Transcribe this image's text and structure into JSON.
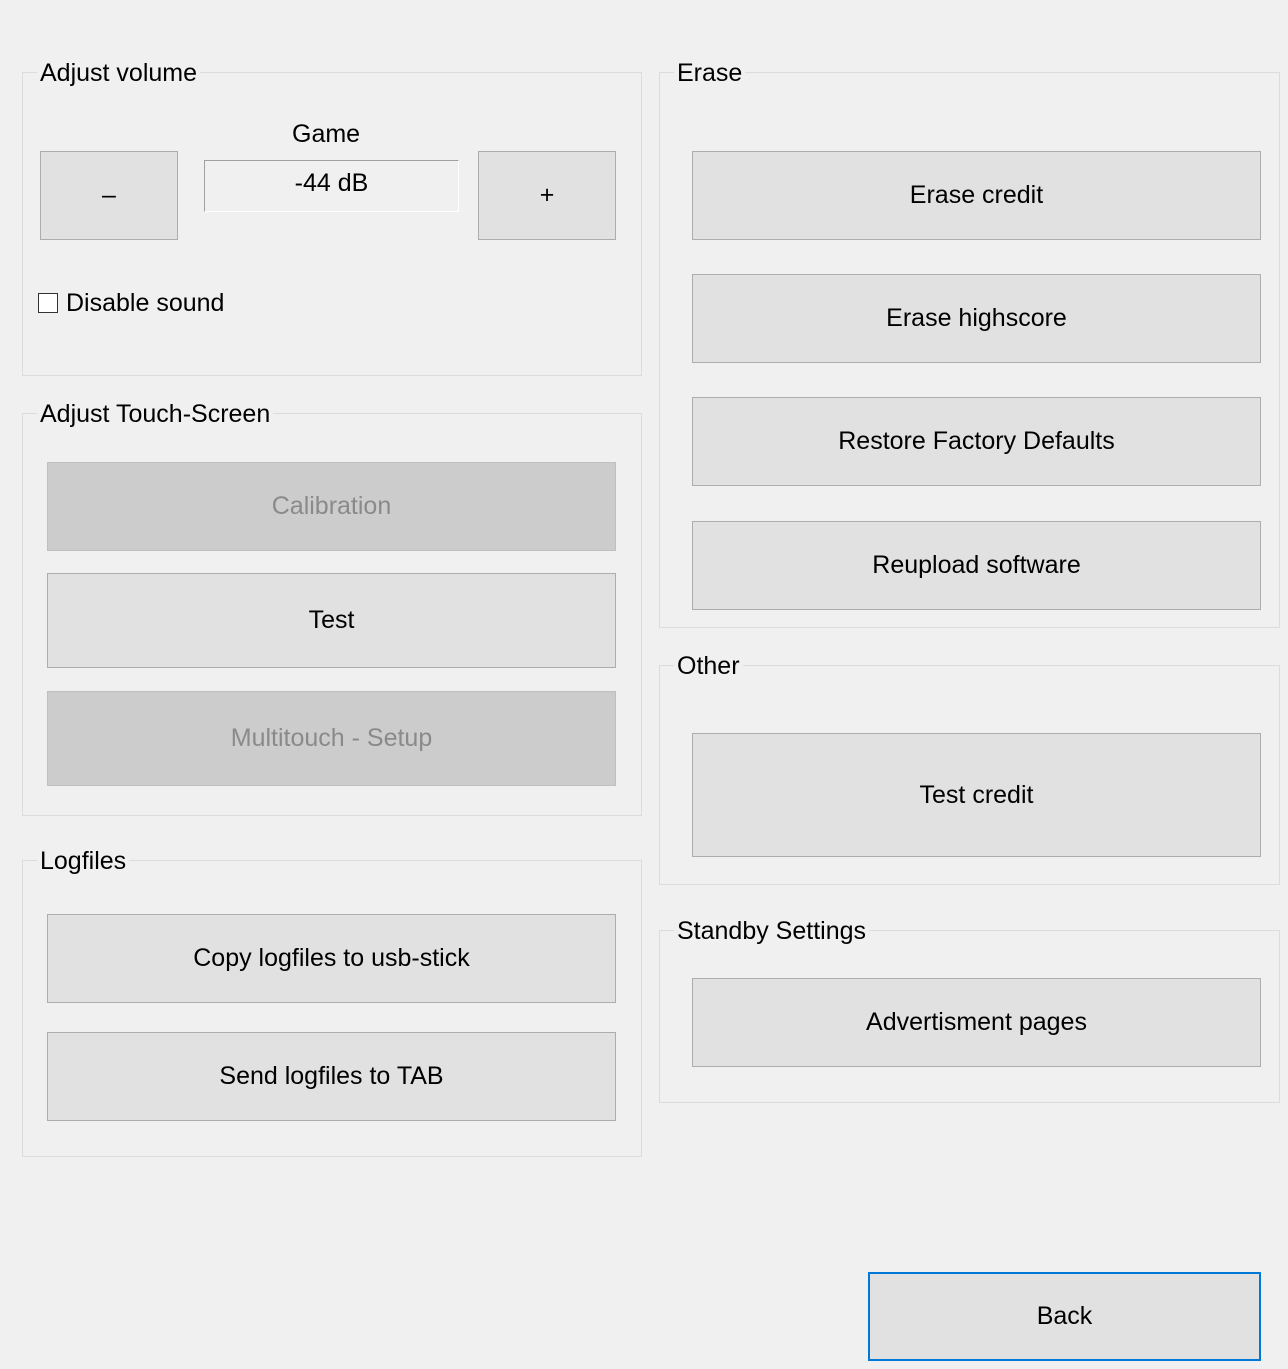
{
  "volume": {
    "title": "Adjust volume",
    "channel_label": "Game",
    "level": "-44 dB",
    "decrease_label": "–",
    "increase_label": "+",
    "disable_sound_label": "Disable sound",
    "disable_sound_checked": false
  },
  "touch": {
    "title": "Adjust Touch-Screen",
    "calibration_label": "Calibration",
    "test_label": "Test",
    "multitouch_label": "Multitouch - Setup"
  },
  "logfiles": {
    "title": "Logfiles",
    "copy_label": "Copy logfiles to usb-stick",
    "send_label": "Send logfiles to TAB"
  },
  "erase": {
    "title": "Erase",
    "erase_credit_label": "Erase credit",
    "erase_highscore_label": "Erase highscore",
    "restore_defaults_label": "Restore Factory Defaults",
    "reupload_label": "Reupload software"
  },
  "other": {
    "title": "Other",
    "test_credit_label": "Test credit"
  },
  "standby": {
    "title": "Standby Settings",
    "advertisment_label": "Advertisment pages"
  },
  "footer": {
    "back_label": "Back"
  },
  "colors": {
    "background": "#f0f0f0",
    "button": "#e1e1e1",
    "button_disabled": "#cccccc",
    "focus_border": "#0078d7"
  }
}
